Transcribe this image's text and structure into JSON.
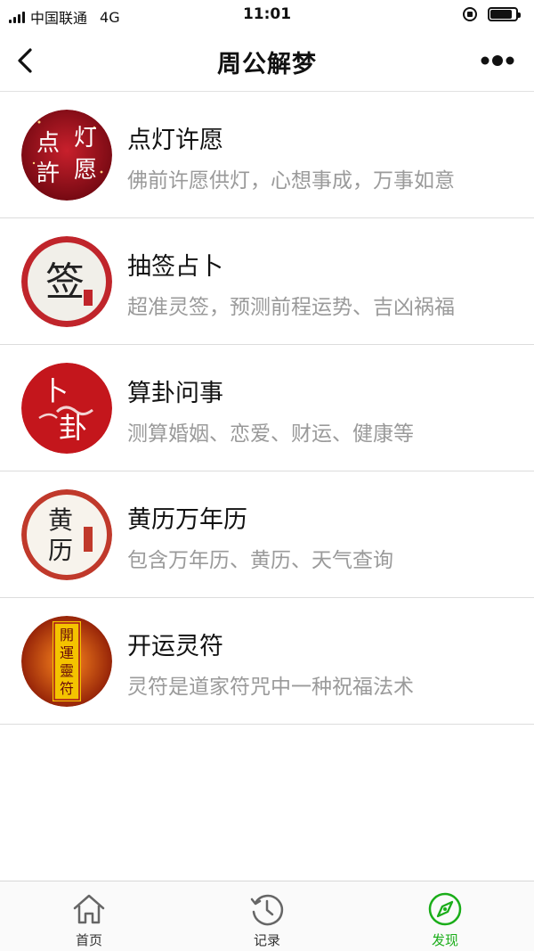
{
  "status_bar": {
    "carrier": "中国联通",
    "network": "4G",
    "time": "11:01",
    "battery_level": 0.85
  },
  "nav": {
    "title": "周公解梦",
    "back_icon": "chevron-left-icon",
    "more_icon": "more-dots-icon"
  },
  "items": [
    {
      "title": "点灯许愿",
      "desc": "佛前许愿供灯，心想事成，万事如意",
      "icon_text": [
        "点",
        "灯",
        "許",
        "愿"
      ],
      "icon_color": "#a3101d"
    },
    {
      "title": "抽签占卜",
      "desc": "超准灵签，预测前程运势、吉凶祸福",
      "icon_text": [
        "签"
      ],
      "icon_color": "#c0252b"
    },
    {
      "title": "算卦问事",
      "desc": "测算婚姻、恋爱、财运、健康等",
      "icon_text": [
        "卜",
        "卦"
      ],
      "icon_color": "#c4161c"
    },
    {
      "title": "黄历万年历",
      "desc": "包含万年历、黄历、天气查询",
      "icon_text": [
        "黄",
        "历"
      ],
      "icon_color": "#c0392b"
    },
    {
      "title": "开运灵符",
      "desc": "灵符是道家符咒中一种祝福法术",
      "icon_text": [
        "開",
        "運",
        "靈",
        "符"
      ],
      "icon_color": "#e8b200"
    }
  ],
  "tabbar": {
    "tabs": [
      {
        "label": "首页",
        "icon": "home-icon",
        "active": false
      },
      {
        "label": "记录",
        "icon": "history-clock-icon",
        "active": false
      },
      {
        "label": "发现",
        "icon": "compass-icon",
        "active": true
      }
    ],
    "active_color": "#1aad19"
  }
}
